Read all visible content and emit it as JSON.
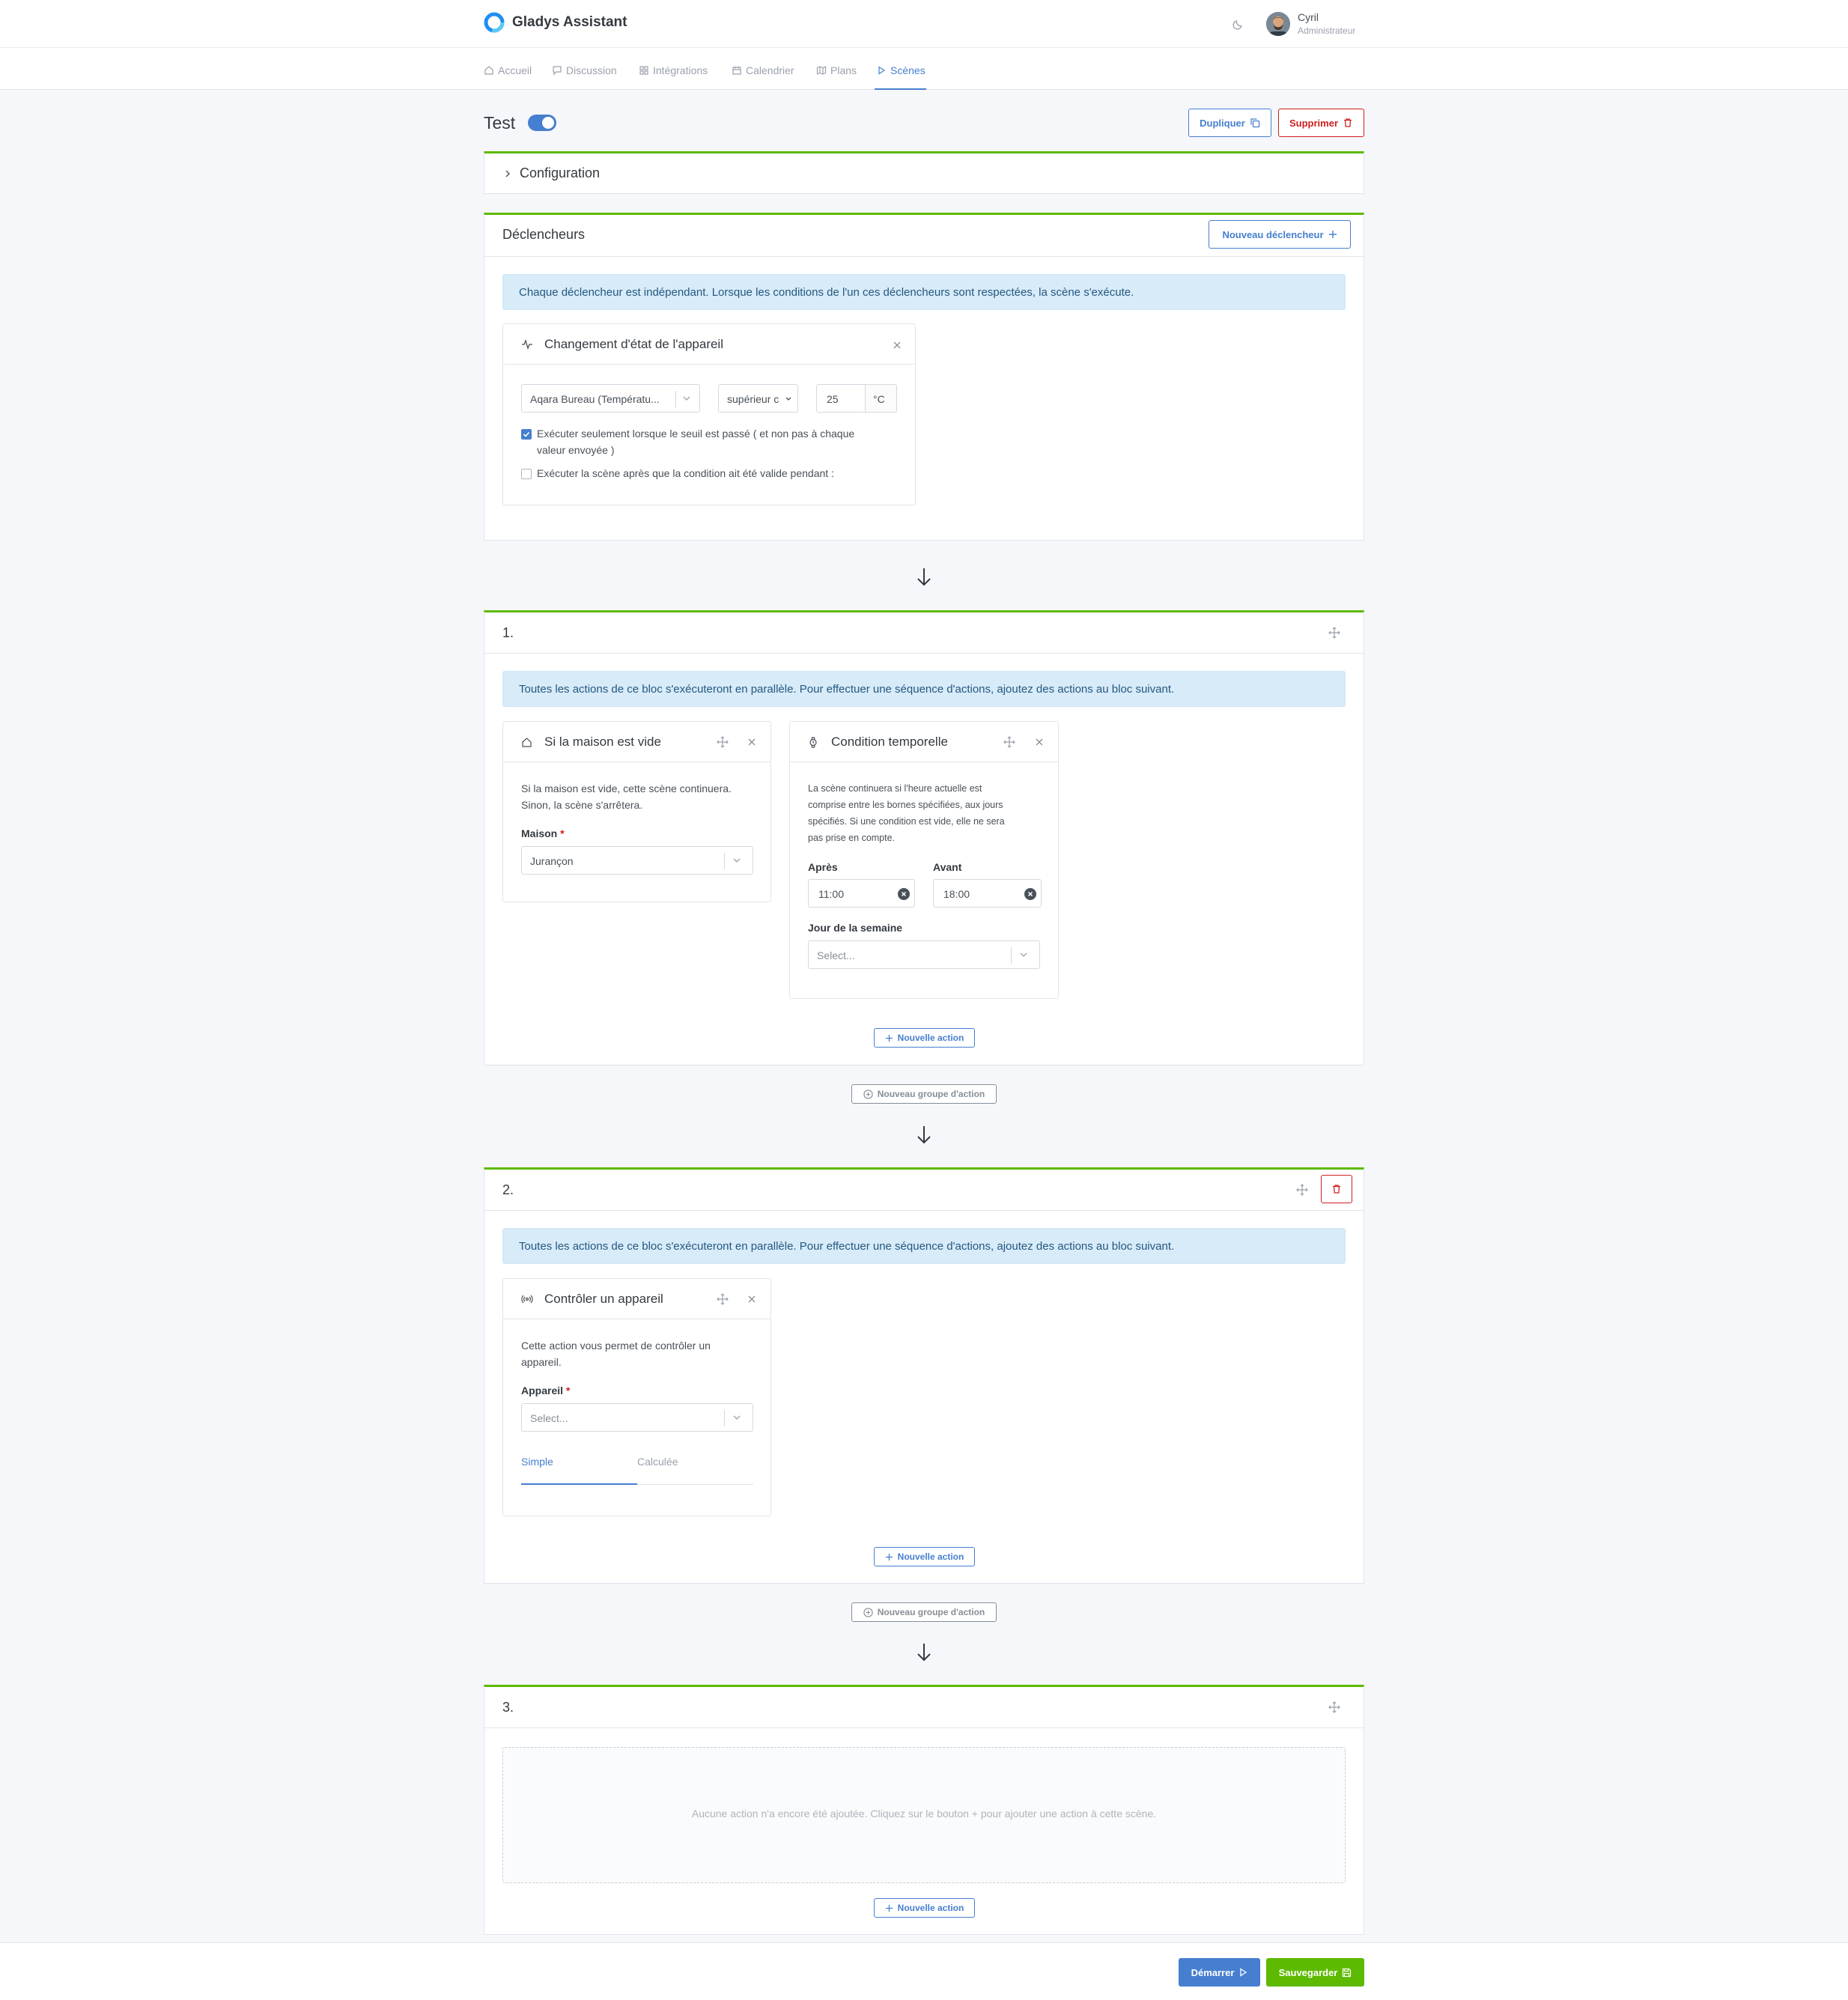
{
  "app": {
    "name": "Gladys Assistant"
  },
  "user": {
    "name": "Cyril",
    "role": "Administrateur"
  },
  "nav": {
    "home": "Accueil",
    "chat": "Discussion",
    "integrations": "Intégrations",
    "calendar": "Calendrier",
    "maps": "Plans",
    "scenes": "Scènes"
  },
  "scene": {
    "title": "Test",
    "enabled": true,
    "duplicate_label": "Dupliquer",
    "delete_label": "Supprimer"
  },
  "configuration": {
    "title": "Configuration"
  },
  "triggers": {
    "title": "Déclencheurs",
    "new_trigger_label": "Nouveau déclencheur",
    "info": "Chaque déclencheur est indépendant. Lorsque les conditions de l'un ces déclencheurs sont respectées, la scène s'exécute.",
    "device_state": {
      "title": "Changement d'état de l'appareil",
      "device_value": "Aqara Bureau (Températu...",
      "operator_value": "supérieur c",
      "threshold_value": "25",
      "unit": "°C",
      "threshold_only_label_line1": "Exécuter seulement lorsque le seuil est passé ( et non pas à chaque",
      "threshold_only_label_line2": "valeur envoyée )",
      "threshold_only_checked": true,
      "delay_label": "Exécuter la scène après que la condition ait été valide pendant :",
      "delay_checked": false
    }
  },
  "parallel_info": "Toutes les actions de ce bloc s'exécuteront en parallèle. Pour effectuer une séquence d'actions, ajoutez des actions au bloc suivant.",
  "group1": {
    "title": "1.",
    "house_empty": {
      "title": "Si la maison est vide",
      "desc_line1": "Si la maison est vide, cette scène continuera.",
      "desc_line2": "Sinon, la scène s'arrêtera.",
      "house_label": "Maison",
      "house_value": "Jurançon"
    },
    "time_condition": {
      "title": "Condition temporelle",
      "desc_line1": "La scène continuera si l'heure actuelle est",
      "desc_line2": "comprise entre les bornes spécifiées, aux jours",
      "desc_line3": "spécifiés. Si une condition est vide, elle ne sera",
      "desc_line4": "pas prise en compte.",
      "after_label": "Après",
      "after_value": "11:00",
      "before_label": "Avant",
      "before_value": "18:00",
      "weekday_label": "Jour de la semaine",
      "weekday_placeholder": "Select..."
    },
    "new_action_label": "Nouvelle action"
  },
  "new_group_label": "Nouveau groupe d'action",
  "group2": {
    "title": "2.",
    "device_control": {
      "title": "Contrôler un appareil",
      "desc_line1": "Cette action vous permet de contrôler un",
      "desc_line2": "appareil.",
      "device_label": "Appareil",
      "device_placeholder": "Select...",
      "tab_simple": "Simple",
      "tab_calculated": "Calculée"
    },
    "new_action_label": "Nouvelle action"
  },
  "group3": {
    "title": "3.",
    "empty_text": "Aucune action n'a encore été ajoutée. Cliquez sur le bouton + pour ajouter une action à cette scène.",
    "new_action_label": "Nouvelle action"
  },
  "footer": {
    "start_label": "Démarrer",
    "save_label": "Sauvegarder"
  },
  "colors": {
    "primary": "#467fcf",
    "danger": "#cd201f",
    "success": "#5eba00",
    "info_bg": "#d8ebf9"
  }
}
